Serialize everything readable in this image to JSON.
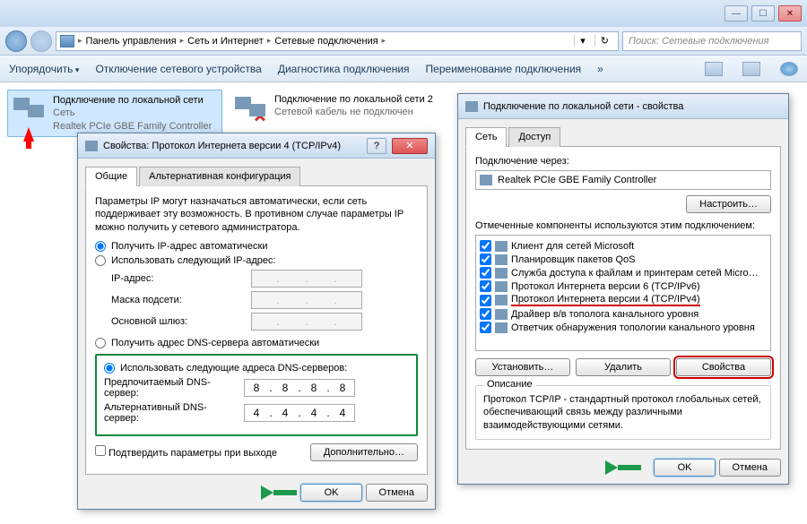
{
  "titlebar": {
    "min": "—",
    "max": "☐",
    "close": "✕"
  },
  "address": {
    "crumbs": [
      "Панель управления",
      "Сеть и Интернет",
      "Сетевые подключения"
    ],
    "search_placeholder": "Поиск: Сетевые подключения"
  },
  "toolbar": {
    "organize": "Упорядочить",
    "disable": "Отключение сетевого устройства",
    "diagnose": "Диагностика подключения",
    "rename": "Переименование подключения"
  },
  "connections": [
    {
      "title": "Подключение по локальной сети",
      "line2": "Сеть",
      "line3": "Realtek PCIe GBE Family Controller"
    },
    {
      "title": "Подключение по локальной сети 2",
      "line2": "Сетевой кабель не подключен",
      "line3": ""
    }
  ],
  "ipv4Dialog": {
    "title": "Свойства: Протокол Интернета версии 4 (TCP/IPv4)",
    "tabs": {
      "general": "Общие",
      "alt": "Альтернативная конфигурация"
    },
    "intro": "Параметры IP могут назначаться автоматически, если сеть поддерживает эту возможность. В противном случае параметры IP можно получить у сетевого администратора.",
    "autoIP": "Получить IP-адрес автоматически",
    "manualIP": "Использовать следующий IP-адрес:",
    "ipLabel": "IP-адрес:",
    "maskLabel": "Маска подсети:",
    "gwLabel": "Основной шлюз:",
    "autoDNS": "Получить адрес DNS-сервера автоматически",
    "manualDNS": "Использовать следующие адреса DNS-серверов:",
    "prefDNS": "Предпочитаемый DNS-сервер:",
    "altDNS": "Альтернативный DNS-сервер:",
    "dns1": [
      "8",
      "8",
      "8",
      "8"
    ],
    "dns2": [
      "4",
      "4",
      "4",
      "4"
    ],
    "confirmExit": "Подтвердить параметры при выходе",
    "advanced": "Дополнительно…",
    "ok": "OK",
    "cancel": "Отмена"
  },
  "propsDialog": {
    "title": "Подключение по локальной сети - свойства",
    "tabs": {
      "net": "Сеть",
      "access": "Доступ"
    },
    "connectVia": "Подключение через:",
    "adapter": "Realtek PCIe GBE Family Controller",
    "configure": "Настроить…",
    "componentsLabel": "Отмеченные компоненты используются этим подключением:",
    "components": [
      "Клиент для сетей Microsoft",
      "Планировщик пакетов QoS",
      "Служба доступа к файлам и принтерам сетей Micro…",
      "Протокол Интернета версии 6 (TCP/IPv6)",
      "Протокол Интернета версии 4 (TCP/IPv4)",
      "Драйвер в/в тополога канального уровня",
      "Ответчик обнаружения топологии канального уровня"
    ],
    "install": "Установить…",
    "remove": "Удалить",
    "properties": "Свойства",
    "descLabel": "Описание",
    "descText": "Протокол TCP/IP - стандартный протокол глобальных сетей, обеспечивающий связь между различными взаимодействующими сетями.",
    "ok": "OK",
    "cancel": "Отмена"
  }
}
